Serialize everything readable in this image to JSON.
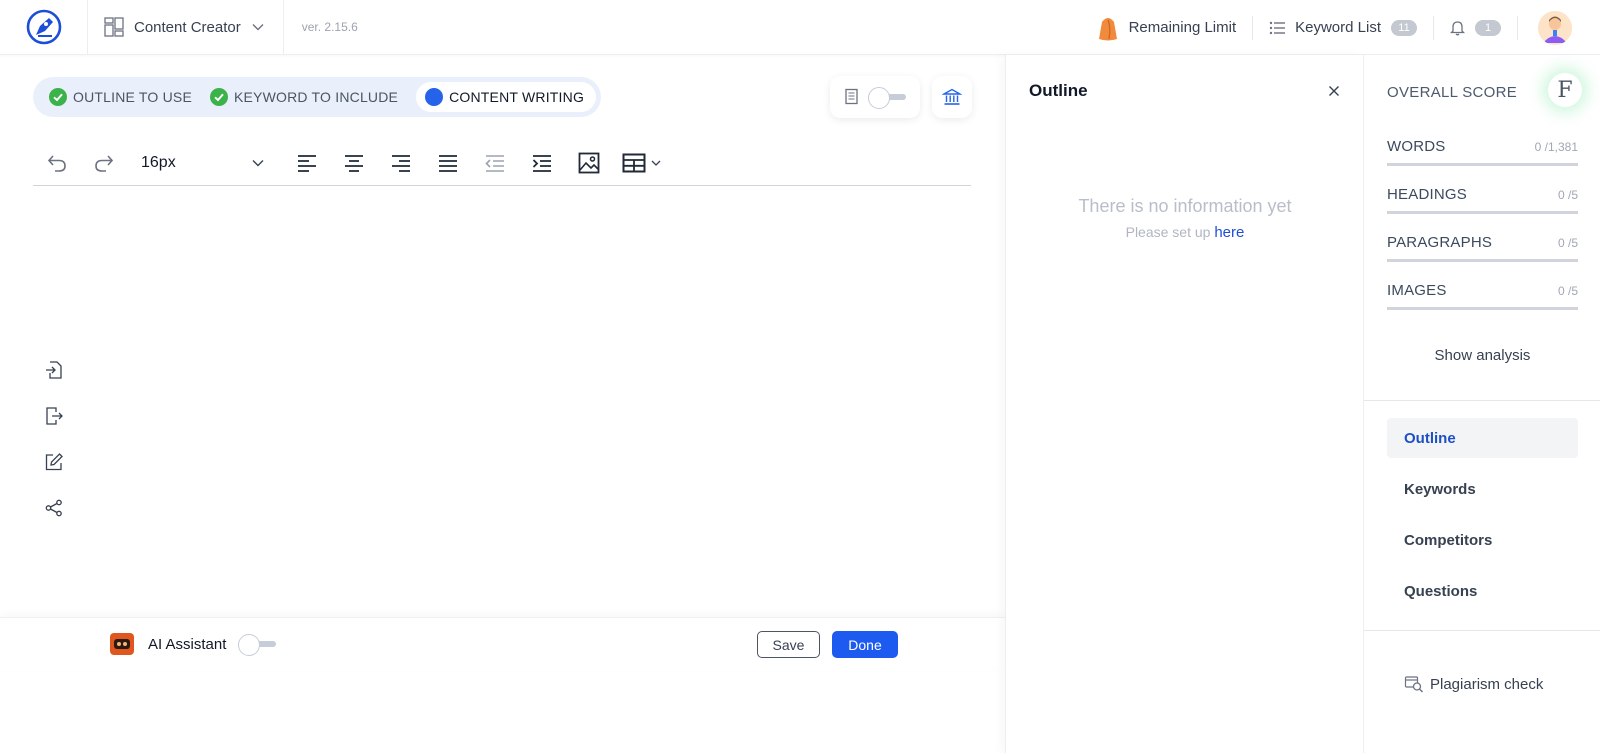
{
  "header": {
    "app_name": "Content Creator",
    "version": "ver. 2.15.6",
    "remaining_limit_label": "Remaining Limit",
    "keyword_list_label": "Keyword List",
    "keyword_list_count": "11",
    "notification_count": "1"
  },
  "steps": [
    {
      "label": "OUTLINE TO USE",
      "status": "done"
    },
    {
      "label": "KEYWORD TO INCLUDE",
      "status": "done"
    },
    {
      "label": "CONTENT WRITING",
      "status": "active"
    }
  ],
  "editor": {
    "font_size": "16px"
  },
  "bottom_bar": {
    "ai_assistant_label": "AI Assistant",
    "save_label": "Save",
    "done_label": "Done"
  },
  "outline_panel": {
    "title": "Outline",
    "empty_title": "There is no information yet",
    "empty_sub": "Please set up here",
    "empty_link": "here"
  },
  "score_panel": {
    "overall_label": "OVERALL SCORE",
    "grade": "F",
    "metrics": [
      {
        "label": "WORDS",
        "value": "0 /1,381"
      },
      {
        "label": "HEADINGS",
        "value": "0 /5"
      },
      {
        "label": "PARAGRAPHS",
        "value": "0 /5"
      },
      {
        "label": "IMAGES",
        "value": "0 /5"
      }
    ],
    "show_analysis": "Show analysis",
    "tabs": [
      {
        "label": "Outline",
        "active": true
      },
      {
        "label": "Keywords",
        "active": false
      },
      {
        "label": "Competitors",
        "active": false
      },
      {
        "label": "Questions",
        "active": false
      }
    ],
    "plagiarism_label": "Plagiarism check"
  },
  "colors": {
    "accent": "#1d5bf0",
    "success": "#3cb34a",
    "active_tab_text": "#1e4fc6"
  }
}
